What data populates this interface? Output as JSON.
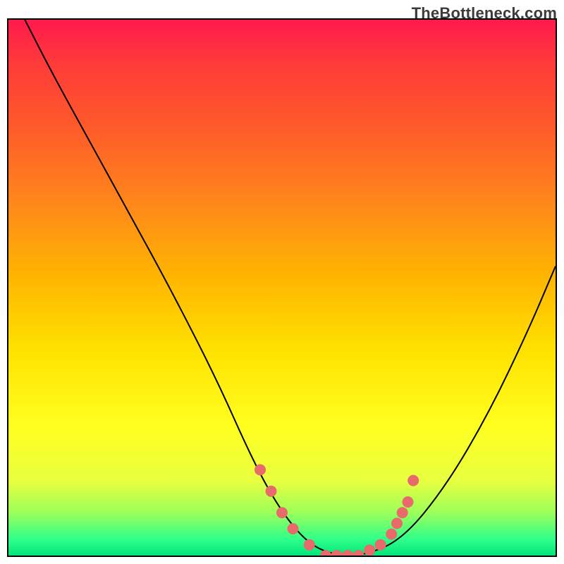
{
  "watermark": "TheBottleneck.com",
  "chart_data": {
    "type": "line",
    "title": "",
    "xlabel": "",
    "ylabel": "",
    "xlim": [
      0,
      100
    ],
    "ylim": [
      0,
      100
    ],
    "grid": false,
    "background_gradient": [
      "#ff1a4d",
      "#ff3a3a",
      "#ff5a2a",
      "#ff8a1a",
      "#ffb500",
      "#ffe200",
      "#ffff20",
      "#e8ff40",
      "#9cff5a",
      "#2fff8a",
      "#00e57a"
    ],
    "curve": {
      "name": "bottleneck-curve",
      "x": [
        3,
        8,
        15,
        22,
        30,
        38,
        45,
        50,
        55,
        60,
        65,
        72,
        80,
        88,
        95,
        100
      ],
      "y": [
        100,
        90,
        77,
        64,
        49,
        33,
        17,
        8,
        2,
        0,
        0,
        3,
        13,
        27,
        42,
        54
      ]
    },
    "highlight_points": {
      "name": "optimal-range-dots",
      "color": "#e86a6a",
      "x": [
        46,
        48,
        50,
        52,
        55,
        58,
        60,
        62,
        64,
        66,
        68,
        70,
        71,
        72,
        73,
        74
      ],
      "y": [
        16,
        12,
        8,
        5,
        2,
        0,
        0,
        0,
        0,
        1,
        2,
        4,
        6,
        8,
        10,
        14
      ]
    }
  }
}
